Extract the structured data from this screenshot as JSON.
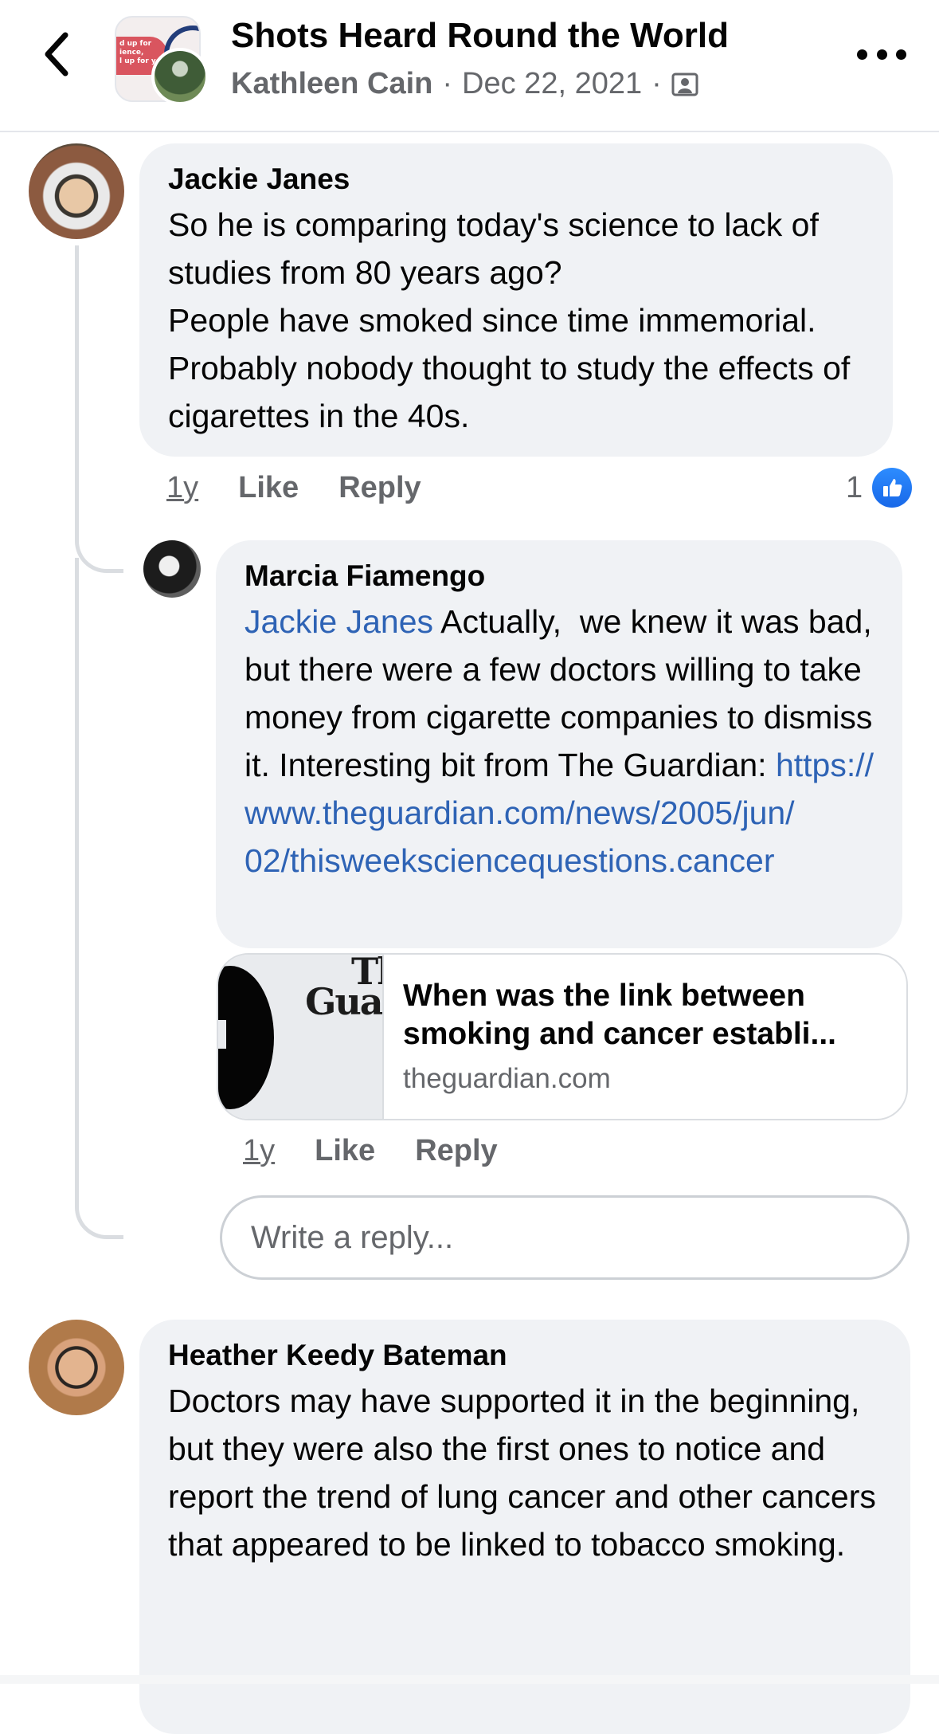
{
  "header": {
    "title": "Shots Heard Round the World",
    "author": "Kathleen Cain",
    "separator": "·",
    "date": "Dec 22, 2021",
    "back_icon": "chevron-left-icon",
    "audience_icon": "members-only-icon",
    "more_icon": "more-horizontal-icon"
  },
  "comments": [
    {
      "name": "Jackie Janes",
      "text": "So he is comparing today's science to lack of studies from 80 years ago?\nPeople have smoked since time immemorial.  Probably nobody thought to study the effects of cigarettes in the 40s.",
      "time": "1y",
      "like_label": "Like",
      "reply_label": "Reply",
      "reaction_count": "1",
      "reaction_icon": "like-icon"
    },
    {
      "name": "Marcia Fiamengo",
      "mention": "Jackie Janes",
      "text": " Actually,  we knew it was bad, but there were a few doctors willing to take money from cigarette companies to dismiss it. Interesting bit from The Guardian: ",
      "link_text": "https://\nwww.theguardian.com/news/2005/jun/\n02/thisweeksciencequestions.cancer",
      "link_preview": {
        "title": "When was the link between smoking and cancer establi...",
        "domain": "theguardian.com",
        "thumb_text": "The\nGuard"
      },
      "time": "1y",
      "like_label": "Like",
      "reply_label": "Reply"
    },
    {
      "name": "Heather Keedy Bateman",
      "text": "Doctors may have supported it in the beginning, but they were also the first ones to notice and report the trend of lung cancer and other cancers that appeared to be linked to tobacco smoking."
    }
  ],
  "reply_input": {
    "placeholder": "Write a reply..."
  },
  "colors": {
    "bubble": "#f0f2f5",
    "link": "#2e63b5",
    "like_blue": "#1877f2",
    "secondary_text": "#65676b"
  }
}
